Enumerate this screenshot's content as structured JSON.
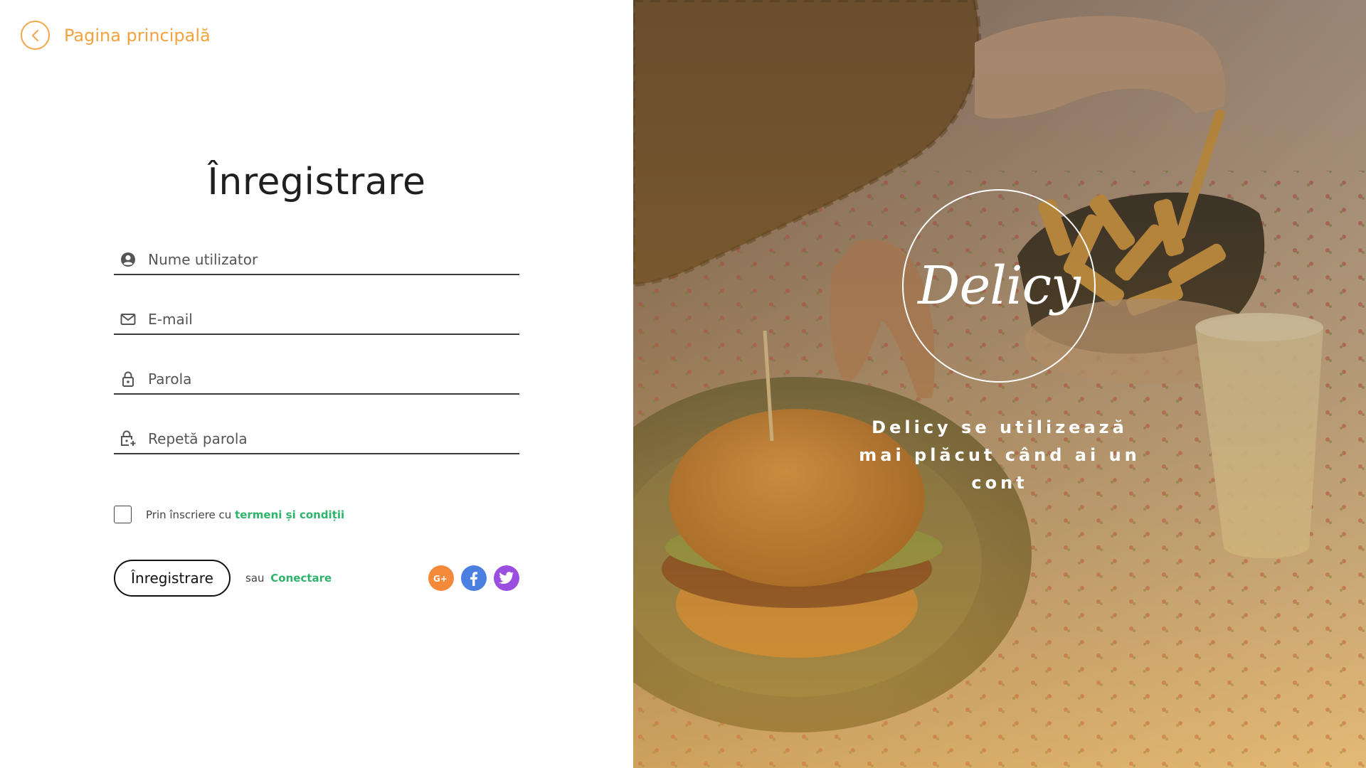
{
  "nav": {
    "home_label": "Pagina principală",
    "back_icon": "chevron-left-icon"
  },
  "form": {
    "title": "Înregistrare",
    "fields": [
      {
        "name": "username",
        "placeholder": "Nume utilizator",
        "icon": "user-icon"
      },
      {
        "name": "email",
        "placeholder": "E-mail",
        "icon": "mail-icon"
      },
      {
        "name": "password",
        "placeholder": "Parola",
        "icon": "lock-icon"
      },
      {
        "name": "repeat_password",
        "placeholder": "Repetă parola",
        "icon": "lock-plus-icon"
      }
    ],
    "terms_prefix": "Prin înscriere cu",
    "terms_link": "termeni și condiții",
    "submit_label": "Înregistrare",
    "or_text": "sau",
    "login_link": "Conectare",
    "socials": [
      {
        "name": "google-plus",
        "label": "G+",
        "color": "#f4893a"
      },
      {
        "name": "facebook",
        "label": "f",
        "color": "#4b80e0"
      },
      {
        "name": "twitter",
        "label": "twitter",
        "color": "#9b4fe0"
      }
    ]
  },
  "hero": {
    "logo": "Delicy",
    "tagline": "Delicy se utilizează mai plăcut când ai un cont"
  },
  "colors": {
    "accent_orange": "#f2a23e",
    "accent_green": "#2fb36a"
  }
}
